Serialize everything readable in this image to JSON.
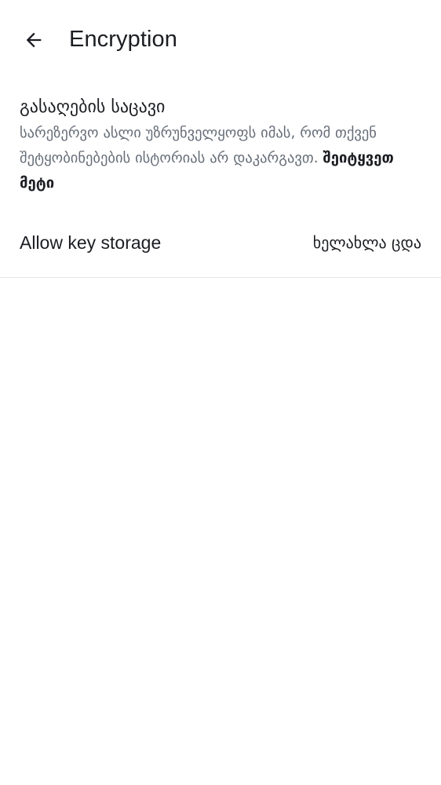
{
  "header": {
    "title": "Encryption",
    "back_icon": "arrow-left-icon"
  },
  "recovery": {
    "title": "გასაღების საცავი",
    "description": "სარეზერვო ასლი უზრუნველყოფს იმას, რომ თქვენ შეტყობინებების ისტორიას არ დაკარგავთ.",
    "learn_more": "შეიტყვეთ მეტი"
  },
  "key_storage": {
    "label": "Allow key storage",
    "retry_label": "ხელახლა ცდა"
  },
  "colors": {
    "text_primary": "#1b1d22",
    "text_secondary": "#656d77",
    "divider": "#e3e5e8",
    "background": "#ffffff"
  }
}
